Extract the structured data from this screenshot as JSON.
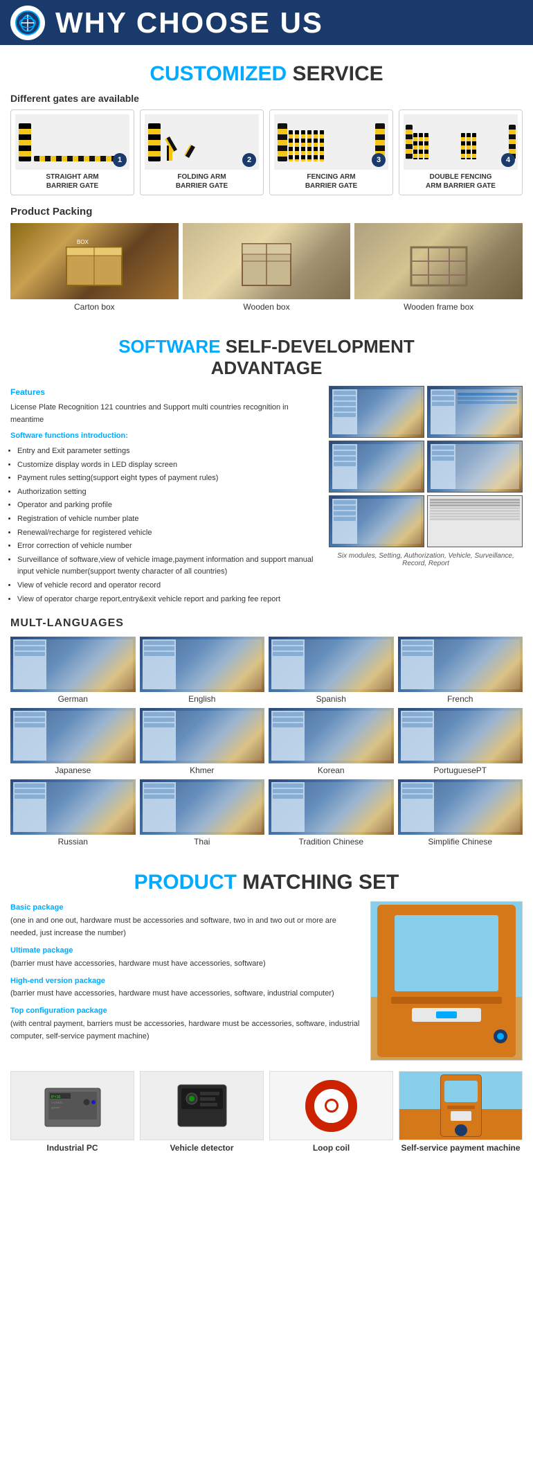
{
  "header": {
    "title": "WHY CHOOSE US",
    "logo_alt": "company-logo"
  },
  "service": {
    "section_title_highlight": "CUSTOMIZED",
    "section_title_normal": " SERVICE",
    "gates_heading": "Different gates are available",
    "gates": [
      {
        "num": "1",
        "label": "STRAIGHT ARM\nBARRIER GATE"
      },
      {
        "num": "2",
        "label": "FOLDING ARM\nBARRIER GATE"
      },
      {
        "num": "3",
        "label": "FENCING ARM\nBARRIER GATE"
      },
      {
        "num": "4",
        "label": "DOUBLE FENCING\nARM BARRIER GATE"
      }
    ],
    "packing_heading": "Product Packing",
    "packing_items": [
      {
        "label": "Carton box"
      },
      {
        "label": "Wooden box"
      },
      {
        "label": "Wooden frame box"
      }
    ]
  },
  "software": {
    "title_highlight": "SOFTWARE",
    "title_normal": " SELF-DEVELOPMENT\nADVANTAGE",
    "features_label": "Features",
    "features_text": "License Plate Recognition 121 countries and Support multi countries recognition in meantime",
    "intro_label": "Software functions introduction:",
    "functions": [
      "Entry and Exit parameter settings",
      "Customize display words in LED display screen",
      "Payment rules setting(support eight types of payment rules)",
      "Authorization setting",
      "Operator and parking profile",
      "Registration of vehicle number plate",
      "Renewal/recharge for registered vehicle",
      "Error correction of vehicle number",
      "Surveillance of software,view of vehicle image,payment information and support manual input vehicle number(support twenty character of all countries)",
      "View of vehicle record and operator record",
      "View of operator charge report,entry&exit vehicle report and parking fee report"
    ],
    "screen_caption": "Six modules, Setting, Authorization, Vehicle, Surveillance, Record, Report"
  },
  "languages": {
    "section_title": "MULT-LANGUAGES",
    "items": [
      "German",
      "English",
      "Spanish",
      "French",
      "Japanese",
      "Khmer",
      "Korean",
      "PortuguesePT",
      "Russian",
      "Thai",
      "Tradition Chinese",
      "Simplifie Chinese"
    ]
  },
  "matching": {
    "title_highlight": "PRODUCT",
    "title_normal": " MATCHING SET",
    "packages": [
      {
        "title": "Basic package",
        "desc": "(one in and one out, hardware must be accessories and software, two in and two out or more are needed, just increase the number)"
      },
      {
        "title": "Ultimate package",
        "desc": "(barrier must have accessories, hardware must have accessories, software)"
      },
      {
        "title": "High-end version package",
        "desc": "(barrier must have accessories, hardware must have accessories, software, industrial computer)"
      },
      {
        "title": "Top configuration package",
        "desc": "(with central payment, barriers must be accessories, hardware must be accessories, software, industrial computer, self-service payment machine)"
      }
    ],
    "products": [
      {
        "label": "Industrial PC"
      },
      {
        "label": "Vehicle detector"
      },
      {
        "label": "Loop coil"
      },
      {
        "label": "Self-service payment machine"
      }
    ]
  }
}
